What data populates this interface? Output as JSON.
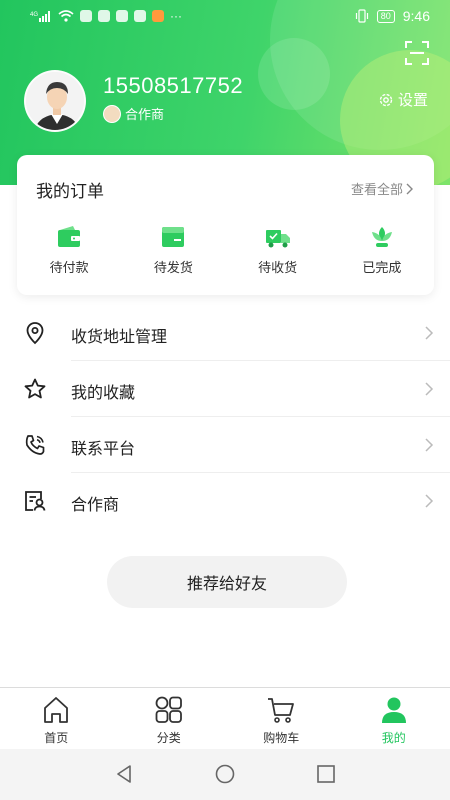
{
  "status_bar": {
    "signal_text": "4G",
    "battery": "80",
    "time": "9:46",
    "icons": [
      "signal-icon",
      "wifi-icon",
      "app-icons",
      "more-dots-icon",
      "vibrate-icon",
      "battery-icon"
    ]
  },
  "header": {
    "phone": "15508517752",
    "role": "合作商",
    "settings_label": "设置",
    "scan_icon": "scan-icon",
    "colors": {
      "gradient_start": "#22c55e",
      "gradient_end": "#7fe46a"
    }
  },
  "orders": {
    "title": "我的订单",
    "view_all": "查看全部",
    "items": [
      {
        "label": "待付款",
        "icon": "wallet-icon"
      },
      {
        "label": "待发货",
        "icon": "package-icon"
      },
      {
        "label": "待收货",
        "icon": "truck-icon"
      },
      {
        "label": "已完成",
        "icon": "lotus-icon"
      }
    ]
  },
  "menu": [
    {
      "label": "收货地址管理",
      "icon": "location-pin-icon"
    },
    {
      "label": "我的收藏",
      "icon": "star-icon"
    },
    {
      "label": "联系平台",
      "icon": "phone-icon"
    },
    {
      "label": "合作商",
      "icon": "partner-card-icon"
    }
  ],
  "recommend_button": "推荐给好友",
  "tabbar": {
    "tabs": [
      {
        "label": "首页",
        "icon": "home-icon",
        "active": false
      },
      {
        "label": "分类",
        "icon": "category-grid-icon",
        "active": false
      },
      {
        "label": "购物车",
        "icon": "cart-icon",
        "active": false
      },
      {
        "label": "我的",
        "icon": "user-icon",
        "active": true
      }
    ],
    "active_color": "#22c55e"
  }
}
